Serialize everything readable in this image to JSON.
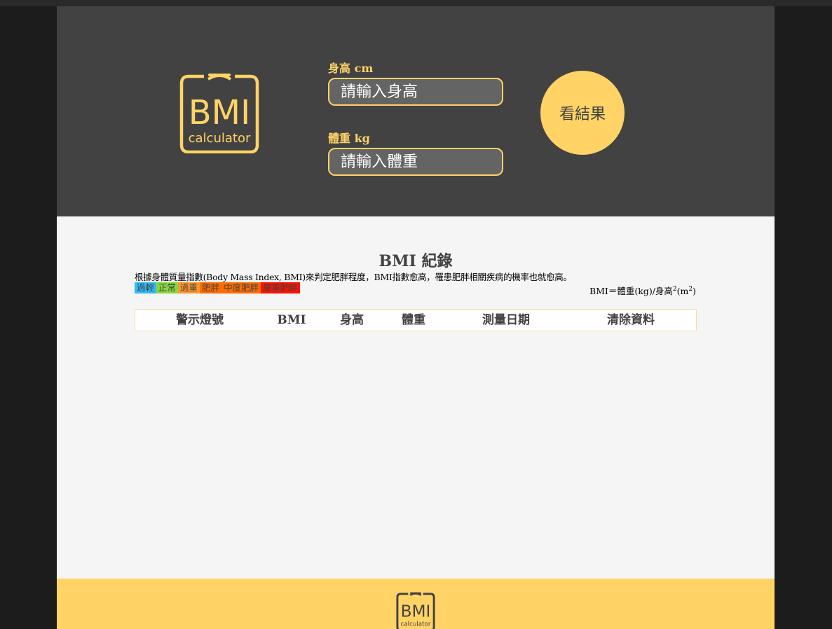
{
  "header": {
    "logo_main": "BMI",
    "logo_sub": "calculator",
    "height_label": "身高 cm",
    "height_placeholder": "請輸入身高",
    "weight_label": "體重 kg",
    "weight_placeholder": "請輸入體重",
    "result_button": "看結果"
  },
  "records": {
    "title": "BMI 紀錄",
    "description": "根據身體質量指數(Body Mass Index, BMI)來判定肥胖程度，BMI指數愈高，罹患肥胖相關疾病的機率也就愈高。",
    "legend": [
      {
        "label": "過輕",
        "color": "#31baf9"
      },
      {
        "label": "正常",
        "color": "#86d73f"
      },
      {
        "label": "過重",
        "color": "#ff982d"
      },
      {
        "label": "肥胖",
        "color": "#ff6c03"
      },
      {
        "label": "中度肥胖",
        "color": "#ff6c03"
      },
      {
        "label": "嚴重肥胖",
        "color": "#ff1200"
      }
    ],
    "formula_prefix": "BMI＝體重(kg)/身高",
    "formula_sup1": "2",
    "formula_unit": "(m",
    "formula_sup2": "2",
    "formula_end": ")",
    "columns": [
      "警示燈號",
      "BMI",
      "身高",
      "體重",
      "測量日期",
      "清除資料"
    ]
  },
  "footer": {
    "logo_main": "BMI",
    "logo_sub": "calculator"
  },
  "colors": {
    "accent": "#ffd366",
    "header_bg": "#424242",
    "input_bg": "#646464",
    "page_bg": "#f5f5f5"
  }
}
